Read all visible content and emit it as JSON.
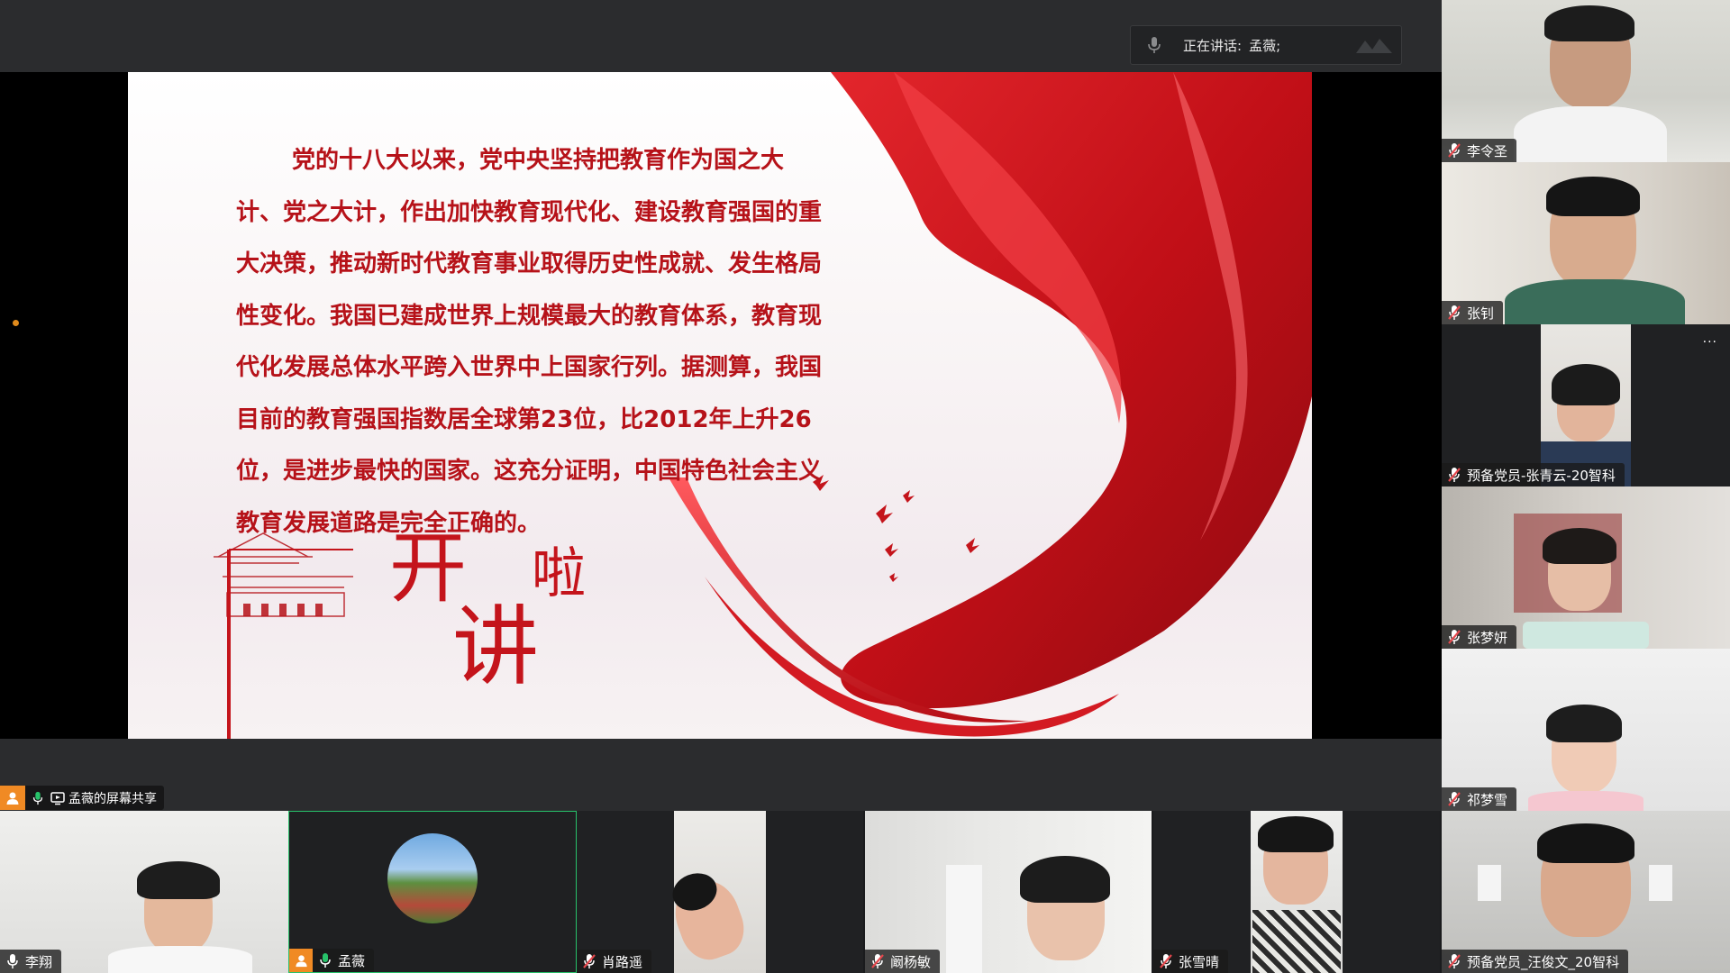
{
  "speaking_indicator": {
    "label": "正在讲话:",
    "speaker": "孟薇;"
  },
  "slide": {
    "paragraph_lines": [
      "党的十八大以来，党中央坚持把教育作为国之大",
      "计、党之大计，作出加快教育现代化、建设教育强国的重",
      "大决策，推动新时代教育事业取得历史性成就、发生格局",
      "性变化。我国已建成世界上规模最大的教育体系，教育现",
      "代化发展总体水平跨入世界中上国家行列。据测算，我国",
      "目前的教育强国指数居全球第23位，比2012年上升26",
      "位，是进步最快的国家。这充分证明，中国特色社会主义",
      "教育发展道路是完全正确的。"
    ],
    "title_char_1": "开",
    "title_char_2": "讲",
    "title_char_3": "啦"
  },
  "screen_share_label": "孟薇的屏幕共享",
  "participants_right": [
    {
      "name": "李令圣"
    },
    {
      "name": "张钊"
    },
    {
      "name": "预备党员-张青云-20智科",
      "more": "···"
    },
    {
      "name": "张梦妍"
    },
    {
      "name": "祁梦雪"
    },
    {
      "name": "预备党员_汪俊文_20智科"
    }
  ],
  "participants_bottom": [
    {
      "name": "李翔"
    },
    {
      "name": "孟薇"
    },
    {
      "name": "肖路遥"
    },
    {
      "name": "阚杨敏"
    },
    {
      "name": "张雪晴"
    }
  ],
  "colors": {
    "accent_green": "#27c26a",
    "slide_red": "#b61219",
    "host_orange": "#f08a24",
    "muted_red": "#e5484d"
  }
}
